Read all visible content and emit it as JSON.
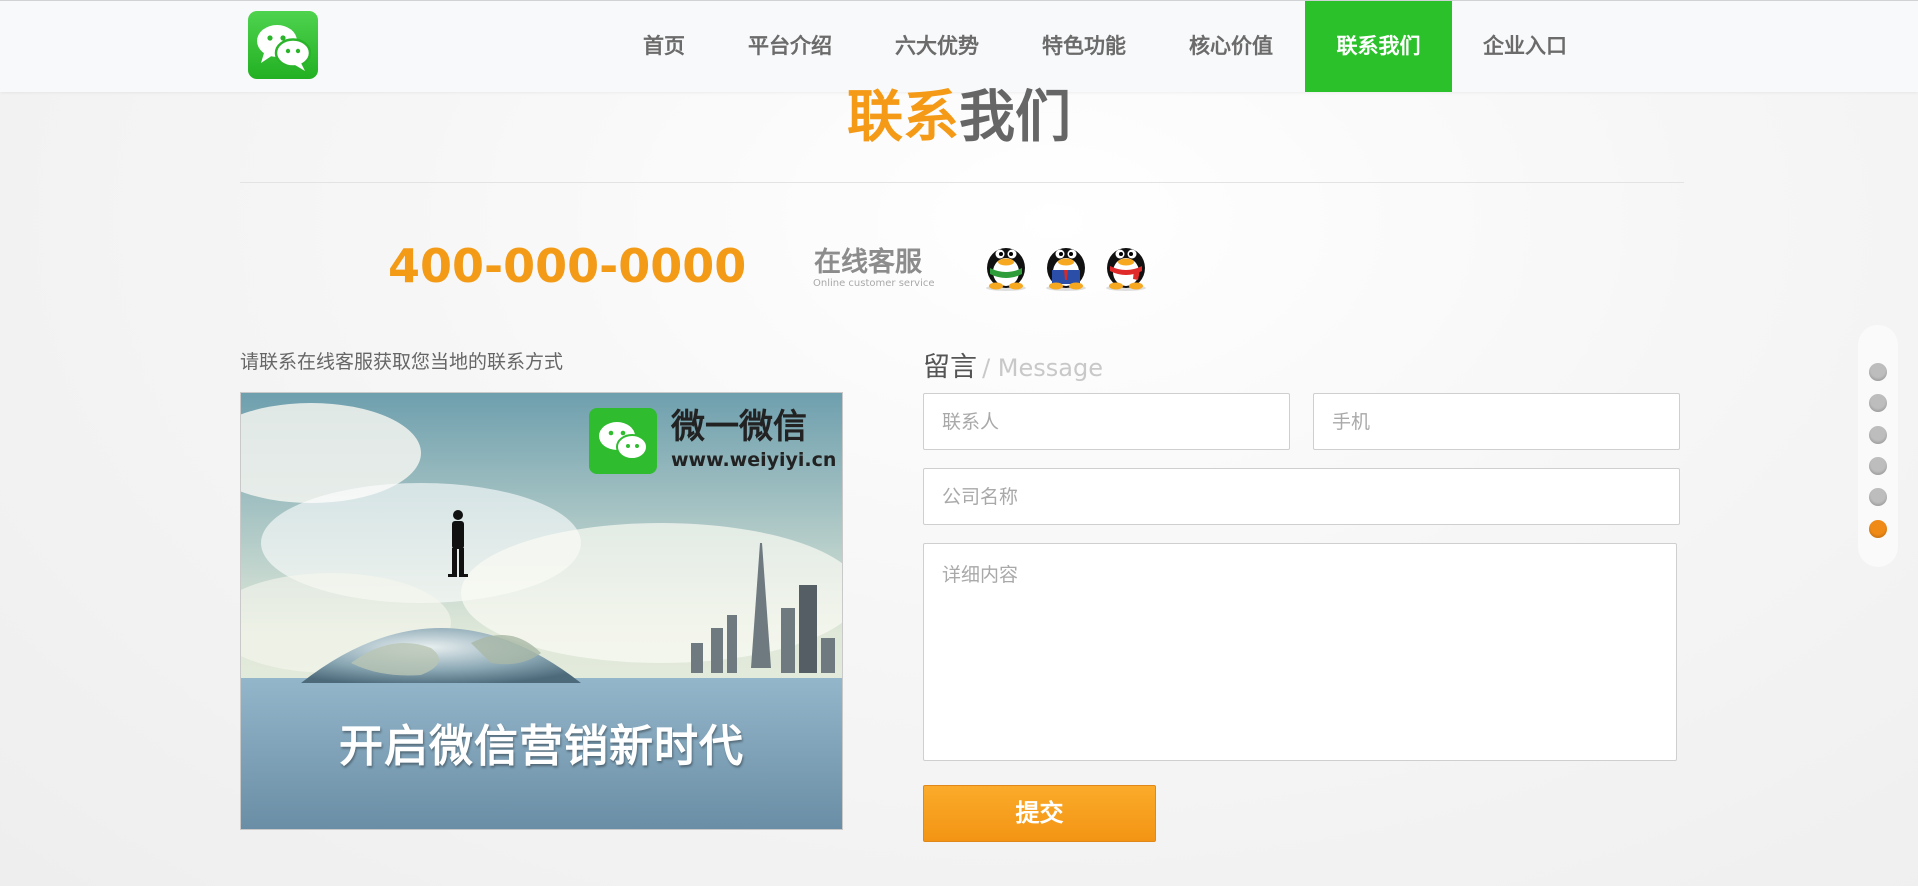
{
  "nav": {
    "items": [
      {
        "label": "首页",
        "active": false
      },
      {
        "label": "平台介绍",
        "active": false
      },
      {
        "label": "六大优势",
        "active": false
      },
      {
        "label": "特色功能",
        "active": false
      },
      {
        "label": "核心价值",
        "active": false
      },
      {
        "label": "联系我们",
        "active": true
      },
      {
        "label": "企业入口",
        "active": false
      }
    ]
  },
  "section": {
    "title_part1": "联系",
    "title_part2": "我们"
  },
  "contact": {
    "phone": "400-000-0000",
    "online_service": "在线客服",
    "online_service_en": "Online customer service",
    "qq_icons": [
      "qq-penguin-green-icon",
      "qq-penguin-blue-icon",
      "qq-penguin-red-icon"
    ]
  },
  "left": {
    "note": "请联系在线客服获取您当地的联系方式",
    "banner": {
      "brand_name": "微一微信",
      "brand_url": "www.weiyiyi.cn",
      "slogan": "开启微信营销新时代"
    }
  },
  "form": {
    "heading": "留言",
    "heading_en": "/ Message",
    "contact_placeholder": "联系人",
    "phone_placeholder": "手机",
    "company_placeholder": "公司名称",
    "detail_placeholder": "详细内容",
    "submit_label": "提交"
  },
  "side_nav": {
    "count": 6,
    "active_index": 5
  },
  "colors": {
    "brand_green": "#2ac12a",
    "accent_orange": "#f39a17"
  }
}
